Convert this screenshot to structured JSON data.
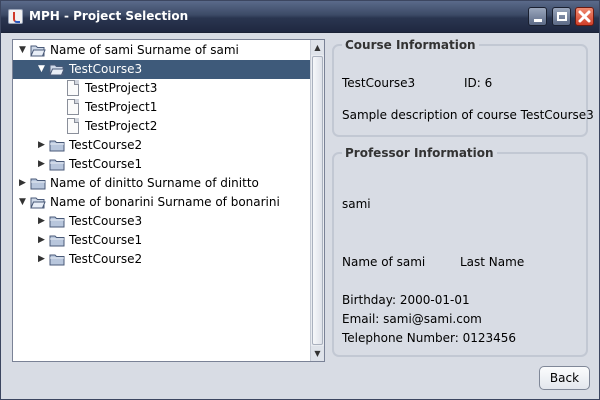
{
  "window": {
    "title": "MPH - Project Selection",
    "icons": {
      "app": "java-app-icon",
      "minimize": "minimize-icon",
      "maximize": "maximize-icon",
      "close": "close-icon"
    },
    "colors": {
      "selection": "#3e5a7a",
      "background": "#d8dce4",
      "close_button": "#d0402a"
    }
  },
  "tree": {
    "nodes": [
      {
        "label": "Name of sami Surname of sami",
        "kind": "folder",
        "expanded": true
      },
      {
        "label": "TestCourse3",
        "kind": "folder",
        "expanded": true,
        "selected": true
      },
      {
        "label": "TestProject3",
        "kind": "file"
      },
      {
        "label": "TestProject1",
        "kind": "file"
      },
      {
        "label": "TestProject2",
        "kind": "file"
      },
      {
        "label": "TestCourse2",
        "kind": "folder",
        "expanded": false
      },
      {
        "label": "TestCourse1",
        "kind": "folder",
        "expanded": false
      },
      {
        "label": "Name of dinitto Surname of dinitto",
        "kind": "folder",
        "expanded": false
      },
      {
        "label": "Name of bonarini Surname of bonarini",
        "kind": "folder",
        "expanded": true
      },
      {
        "label": "TestCourse3",
        "kind": "folder",
        "expanded": false
      },
      {
        "label": "TestCourse1",
        "kind": "folder",
        "expanded": false
      },
      {
        "label": "TestCourse2",
        "kind": "folder",
        "expanded": false
      }
    ]
  },
  "course": {
    "title": "Course Information",
    "name": "TestCourse3",
    "id": "ID: 6",
    "description": "Sample description of course TestCourse3"
  },
  "professor": {
    "title": "Professor Information",
    "username": "sami",
    "name": "Name of sami",
    "last_name": "Last Name",
    "birthday": "Birthday: 2000-01-01",
    "email": "Email: sami@sami.com",
    "telephone": "Telephone Number: 0123456"
  },
  "buttons": {
    "back": "Back"
  }
}
